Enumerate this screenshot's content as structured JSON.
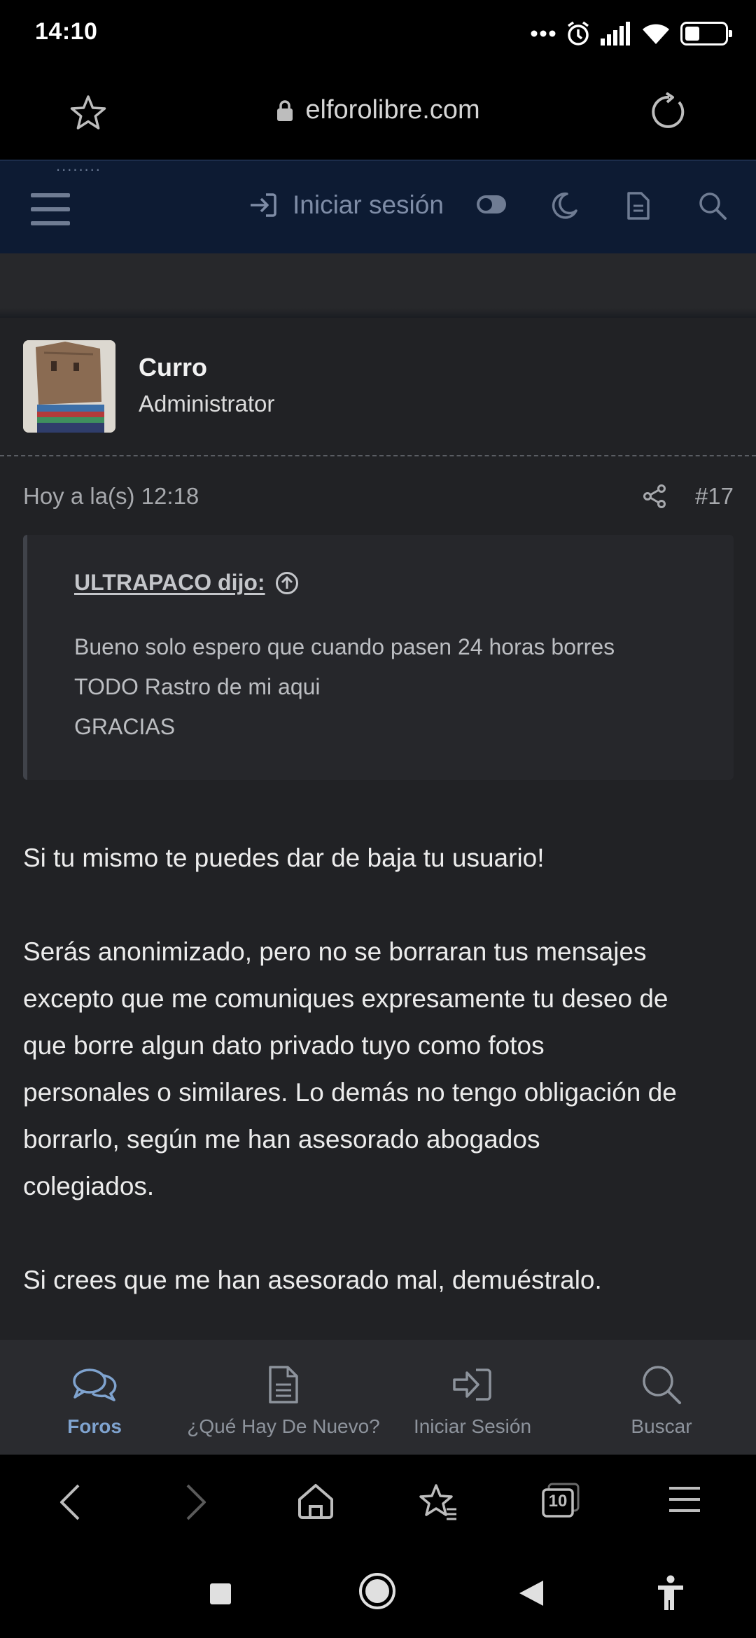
{
  "status_bar": {
    "time": "14:10",
    "battery_level": 0.35
  },
  "browser": {
    "url": "elforolibre.com"
  },
  "forum_header": {
    "peek_text": "........",
    "login_label": "Iniciar sesión"
  },
  "post": {
    "author_name": "Curro",
    "author_role": "Administrator",
    "timestamp": "Hoy a la(s) 12:18",
    "post_number": "#17",
    "quote": {
      "author": "ULTRAPACO dijo:",
      "lines": [
        "Bueno solo espero que cuando pasen 24 horas borres",
        "TODO Rastro de mi aqui",
        "GRACIAS"
      ]
    },
    "message": {
      "p1": "Si tu mismo te puedes dar de baja tu usuario!",
      "p2_lines": [
        "Serás anonimizado, pero no se borraran tus mensajes",
        "excepto que me comuniques expresamente tu deseo de",
        "que borre algun dato privado tuyo como fotos",
        "personales o similares. Lo demás no tengo obligación de",
        "borrarlo, según me han asesorado abogados",
        "colegiados."
      ],
      "p3": "Si crees que me han asesorado mal, demuéstralo."
    }
  },
  "forum_nav": {
    "items": [
      {
        "label": "Foros",
        "icon": "chat-bubbles-icon",
        "active": true
      },
      {
        "label": "¿Qué Hay De Nuevo?",
        "icon": "document-icon",
        "active": false
      },
      {
        "label": "Iniciar Sesión",
        "icon": "sign-in-icon",
        "active": false
      },
      {
        "label": "Buscar",
        "icon": "search-icon",
        "active": false
      }
    ]
  },
  "browser_toolbar": {
    "tab_count": "10"
  },
  "colors": {
    "header_bg": "#0d1b33",
    "post_bg": "#212225",
    "nav_bg": "#2a2b2f",
    "active_nav": "#7fa3cf",
    "muted_text": "#a7a9ad"
  }
}
